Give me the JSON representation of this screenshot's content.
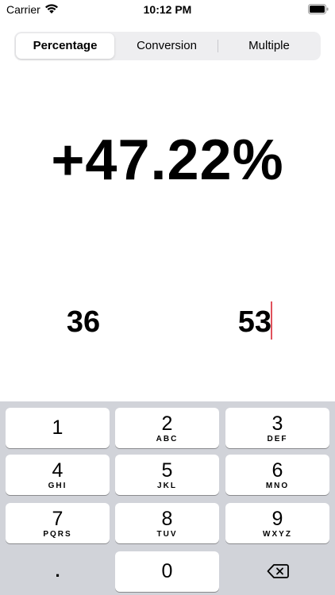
{
  "status_bar": {
    "carrier": "Carrier",
    "time": "10:12 PM",
    "icons": [
      "wifi-icon",
      "battery-icon"
    ]
  },
  "segmented_control": {
    "segments": [
      "Percentage",
      "Conversion",
      "Multiple"
    ],
    "selected": "Percentage"
  },
  "result": {
    "value": "+47.22%"
  },
  "inputs": {
    "from_value": "36",
    "to_value": "53",
    "caret_color": "#e0525c"
  },
  "keypad": {
    "keys": [
      {
        "digit": "1",
        "letters": ""
      },
      {
        "digit": "2",
        "letters": "ABC"
      },
      {
        "digit": "3",
        "letters": "DEF"
      },
      {
        "digit": "4",
        "letters": "GHI"
      },
      {
        "digit": "5",
        "letters": "JKL"
      },
      {
        "digit": "6",
        "letters": "MNO"
      },
      {
        "digit": "7",
        "letters": "PQRS"
      },
      {
        "digit": "8",
        "letters": "TUV"
      },
      {
        "digit": "9",
        "letters": "WXYZ"
      },
      {
        "digit": "0",
        "letters": ""
      }
    ],
    "decimal_key": ".",
    "delete_icon": "delete-backspace-icon",
    "background": "#d1d3d9"
  }
}
